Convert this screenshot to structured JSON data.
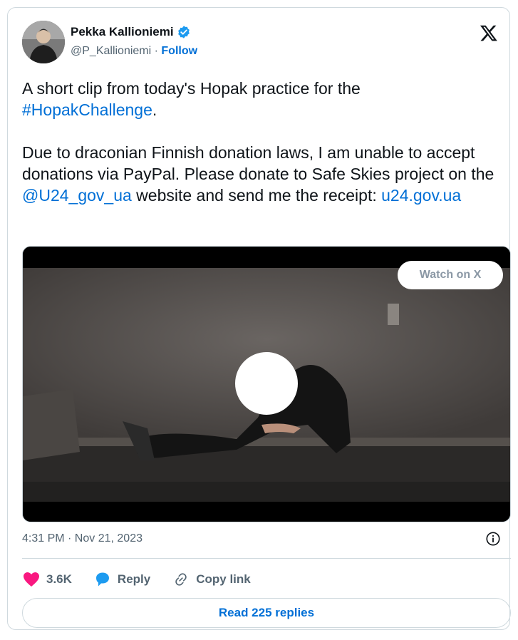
{
  "author": {
    "name": "Pekka Kallioniemi",
    "handle": "@P_Kallioniemi",
    "separator": " · ",
    "follow_label": "Follow"
  },
  "tweet": {
    "line1_text": "A short clip from today's Hopak practice for the ",
    "hashtag": "#HopakChallenge",
    "line1_end": ".",
    "para2_text": "Due to draconian Finnish donation laws, I am unable to accept donations via PayPal. Please donate to Safe Skies project on the ",
    "mention": "@U24_gov_ua",
    "para2_mid": " website and send me the receipt: ",
    "url": "u24.gov.ua"
  },
  "media": {
    "watch_label": "Watch on X"
  },
  "timestamp": "4:31 PM · Nov 21, 2023",
  "actions": {
    "likes_count": "3.6K",
    "reply_label": "Reply",
    "copy_label": "Copy link"
  },
  "read_replies_label": "Read 225 replies",
  "colors": {
    "link": "#006fd6",
    "like": "#f91880",
    "verified": "#1d9bf0",
    "reply": "#1d9bf0"
  }
}
